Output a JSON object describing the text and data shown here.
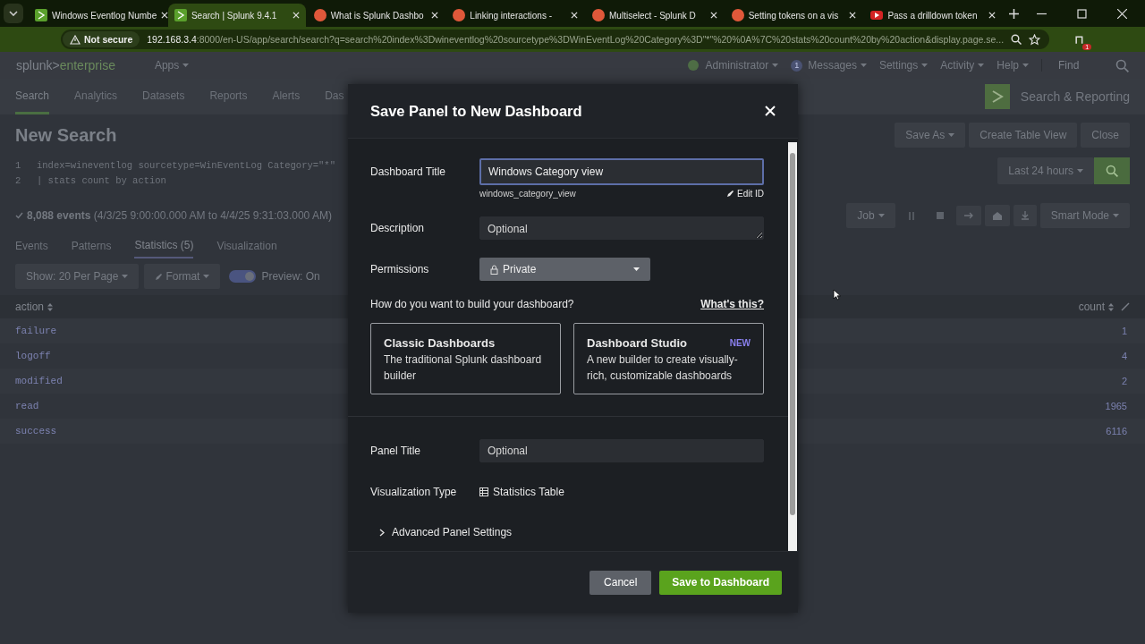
{
  "browser": {
    "tabs": [
      {
        "title": "Windows Eventlog Numbe",
        "kind": "splunk",
        "selected": false
      },
      {
        "title": "Search | Splunk 9.4.1",
        "kind": "splunk",
        "selected": true
      },
      {
        "title": "What is Splunk Dashbo",
        "kind": "web",
        "selected": false
      },
      {
        "title": "Linking interactions -",
        "kind": "web",
        "selected": false
      },
      {
        "title": "Multiselect - Splunk D",
        "kind": "web",
        "selected": false
      },
      {
        "title": "Setting tokens on a vis",
        "kind": "web",
        "selected": false
      },
      {
        "title": "Pass a drilldown token",
        "kind": "video",
        "selected": false
      }
    ],
    "address": {
      "security": "Not secure",
      "host": "192.168.3.4",
      "rest": ":8000/en-US/app/search/search?q=search%20index%3Dwineventlog%20sourcetype%3DWinEventLog%20Category%3D\"*\"%20%0A%7C%20stats%20count%20by%20action&display.page.se..."
    },
    "extension_badge": "1"
  },
  "splunk": {
    "brand": {
      "left": "splunk>",
      "right": "enterprise"
    },
    "apps": "Apps",
    "header_menu": [
      {
        "label": "Administrator",
        "kind": "status"
      },
      {
        "label": "Messages",
        "kind": "badge",
        "badge": "1"
      },
      {
        "label": "Settings",
        "kind": "plain"
      },
      {
        "label": "Activity",
        "kind": "plain"
      },
      {
        "label": "Help",
        "kind": "plain"
      }
    ],
    "find": "Find",
    "nav": [
      {
        "label": "Search",
        "selected": true
      },
      {
        "label": "Analytics",
        "selected": false
      },
      {
        "label": "Datasets",
        "selected": false
      },
      {
        "label": "Reports",
        "selected": false
      },
      {
        "label": "Alerts",
        "selected": false
      },
      {
        "label": "Das",
        "selected": false
      }
    ],
    "app_title": "Search & Reporting",
    "page_title": "New Search",
    "actions": [
      "Save As",
      "Create Table View",
      "Close"
    ],
    "query": [
      {
        "line": "1",
        "text": "index=wineventlog sourcetype=WinEventLog Category=\"*\""
      },
      {
        "line": "2",
        "text": "| stats count by action"
      }
    ],
    "time_picker": "Last 24 hours",
    "status": {
      "count": "8,088 events",
      "range": "(4/3/25 9:00:00.000 AM to 4/4/25 9:31:03.000 AM)"
    },
    "job": "Job",
    "mode": "Smart Mode",
    "result_tabs": [
      {
        "label": "Events",
        "selected": false
      },
      {
        "label": "Patterns",
        "selected": false
      },
      {
        "label": "Statistics (5)",
        "selected": true
      },
      {
        "label": "Visualization",
        "selected": false
      }
    ],
    "per_page": "Show: 20 Per Page",
    "format": "Format",
    "preview": {
      "on": true,
      "label": "Preview: On"
    },
    "table": {
      "columns": [
        "action",
        "count"
      ],
      "rows": [
        [
          "failure",
          "1"
        ],
        [
          "logoff",
          "4"
        ],
        [
          "modified",
          "2"
        ],
        [
          "read",
          "1965"
        ],
        [
          "success",
          "6116"
        ]
      ]
    }
  },
  "dialog": {
    "title": "Save Panel to New Dashboard",
    "dashboard_title": {
      "label": "Dashboard Title",
      "value": "Windows Category view",
      "id": "windows_category_view",
      "edit_id": "Edit ID"
    },
    "description": {
      "label": "Description",
      "placeholder": "Optional"
    },
    "permissions": {
      "label": "Permissions",
      "value": "Private"
    },
    "question": "How do you want to build your dashboard?",
    "help_link": "What's this?",
    "options": [
      {
        "title": "Classic Dashboards",
        "description": "The traditional Splunk dashboard builder",
        "selected": false
      },
      {
        "title": "Dashboard Studio",
        "badge": "NEW",
        "description": "A new builder to create visually-rich, customizable dashboards",
        "selected": false
      }
    ],
    "panel_title": {
      "label": "Panel Title",
      "placeholder": "Optional"
    },
    "visualization": {
      "label": "Visualization Type",
      "value": "Statistics Table"
    },
    "advanced": {
      "label": "Advanced Panel Settings",
      "expanded": false
    },
    "buttons": [
      "Cancel",
      "Save to Dashboard"
    ]
  }
}
